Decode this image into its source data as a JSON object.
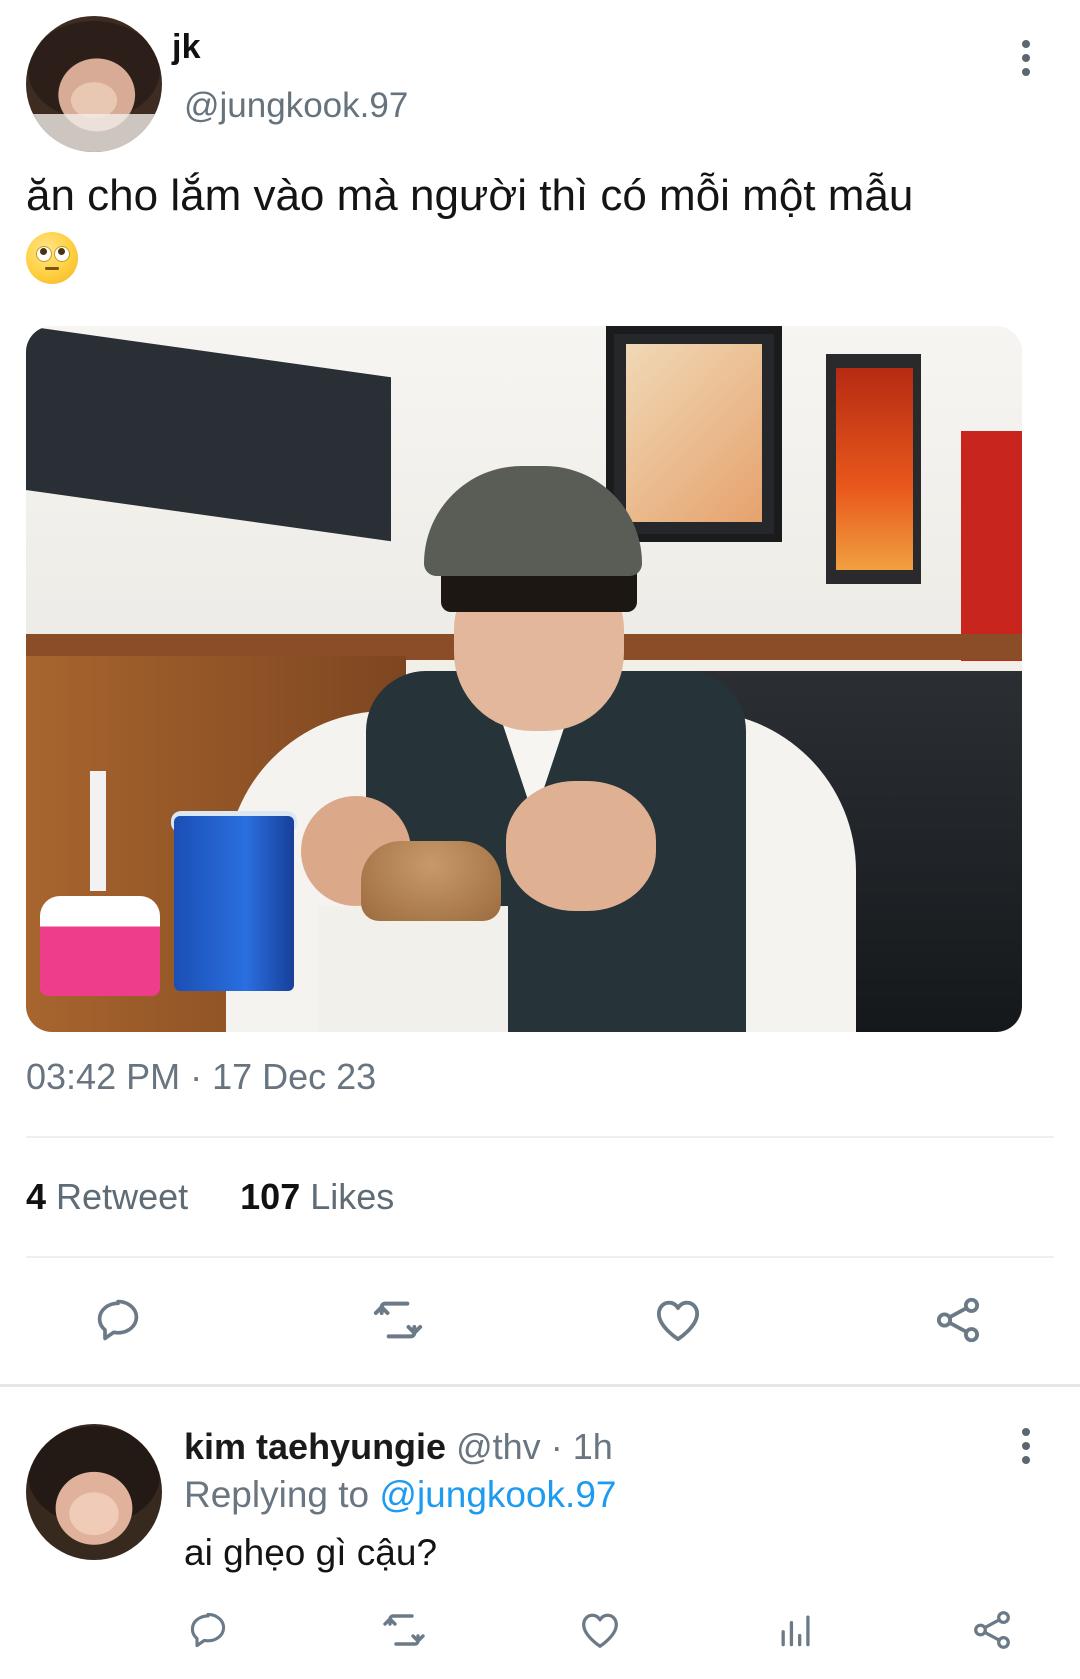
{
  "tweet": {
    "author_name": "jk",
    "author_handle": "@jungkook.97",
    "text": "ăn cho lắm vào mà người thì có mỗi một mẫu",
    "timestamp": "03:42 PM · 17 Dec 23",
    "retweet_count": "4",
    "retweet_label": "Retweet",
    "like_count": "107",
    "like_label": "Likes",
    "icons": [
      "more-vertical-icon",
      "eye-roll-emoji",
      "reply-icon",
      "retweet-icon",
      "like-icon",
      "share-icon"
    ]
  },
  "reply": {
    "author_name": "kim taehyungie",
    "author_handle": "@thv",
    "time": "1h",
    "replying_prefix": "Replying to",
    "replying_to": "@jungkook.97",
    "text": "ai ghẹo gì cậu?",
    "icons": [
      "reply-icon",
      "retweet-icon",
      "like-icon",
      "analytics-icon",
      "share-icon"
    ]
  },
  "colors": {
    "text_primary": "#0f1419",
    "text_secondary": "#687480",
    "link": "#1d9bf0",
    "icon": "#6b7a86",
    "divider": "#eceeef"
  }
}
